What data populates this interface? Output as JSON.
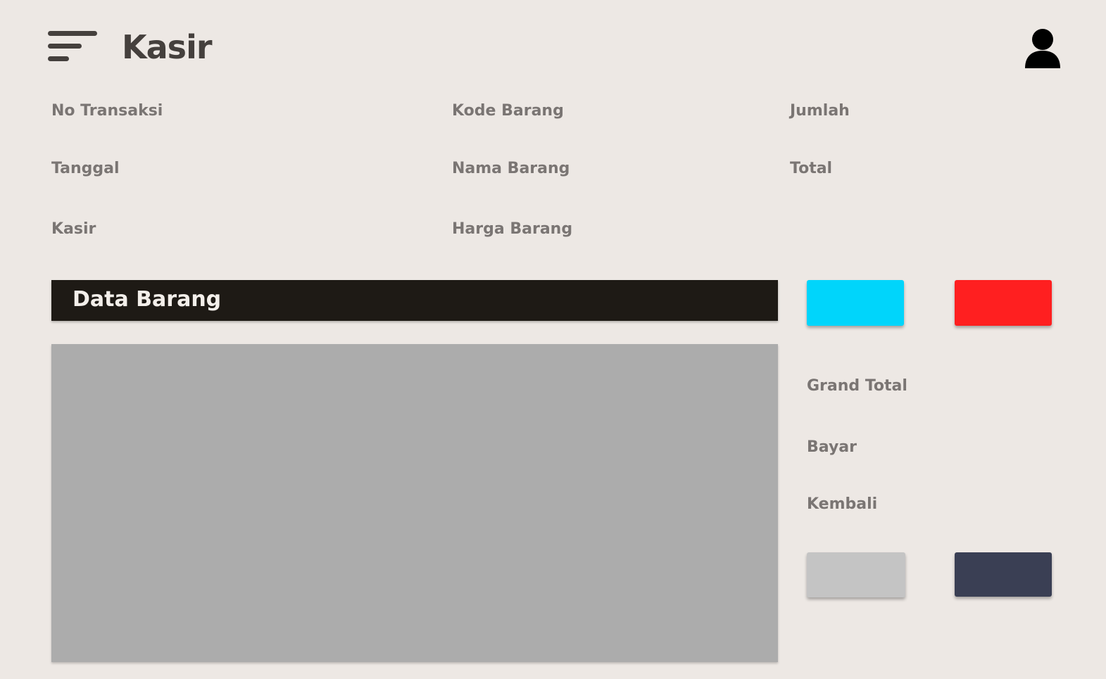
{
  "header": {
    "title": "Kasir",
    "menu_icon": "hamburger-menu-icon",
    "user_icon": "user-profile-icon"
  },
  "form": {
    "no_transaksi": "No Transaksi",
    "tanggal": "Tanggal",
    "kasir": "Kasir",
    "kode_barang": "Kode Barang",
    "nama_barang": "Nama Barang",
    "harga_barang": "Harga Barang",
    "jumlah": "Jumlah",
    "total": "Total"
  },
  "data_barang": {
    "title": "Data Barang"
  },
  "summary": {
    "grand_total": "Grand Total",
    "bayar": "Bayar",
    "kembali": "Kembali"
  },
  "colors": {
    "background": "#ede8e4",
    "header_bar": "#1e1a15",
    "table_placeholder": "#acacac",
    "button_cyan": "#00d5fb",
    "button_red": "#ff1f20",
    "button_gray": "#c4c4c4",
    "button_navy": "#3a3f54"
  }
}
